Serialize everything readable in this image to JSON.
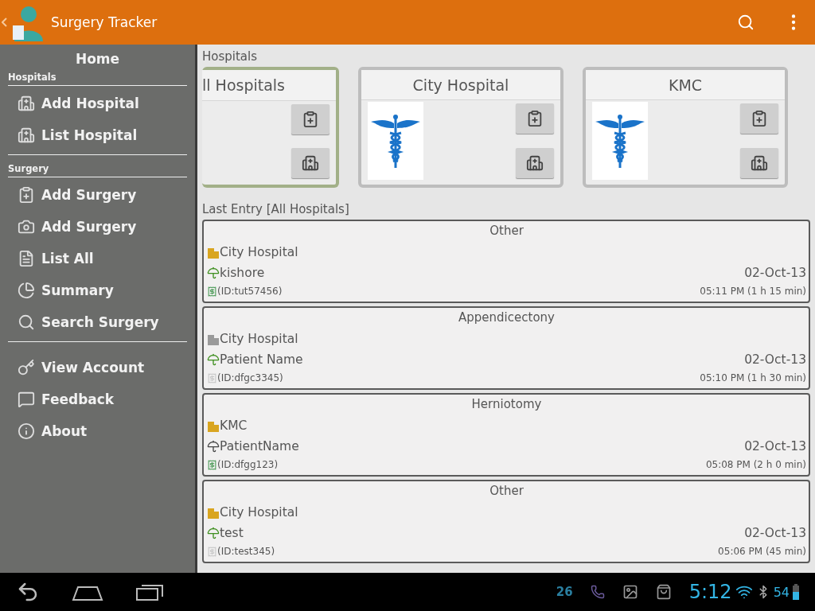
{
  "app_bar": {
    "title": "Surgery Tracker"
  },
  "drawer": {
    "title": "Home",
    "sections": [
      {
        "header": "Hospitals",
        "items": [
          {
            "label": "Add Hospital"
          },
          {
            "label": "List Hospital"
          }
        ]
      },
      {
        "header": "Surgery",
        "items": [
          {
            "label": "Add Surgery"
          },
          {
            "label": "Add Surgery"
          },
          {
            "label": "List All"
          },
          {
            "label": "Summary"
          },
          {
            "label": "Search Surgery"
          }
        ]
      },
      {
        "items": [
          {
            "label": "View Account"
          },
          {
            "label": "Feedback"
          },
          {
            "label": "About"
          }
        ]
      }
    ]
  },
  "hospitals": {
    "label": "Hospitals",
    "cards": [
      {
        "name": "ll Hospitals",
        "kind": "all",
        "selected": true
      },
      {
        "name": "City Hospital",
        "kind": "hospital",
        "selected": false
      },
      {
        "name": "KMC",
        "kind": "hospital",
        "selected": false
      }
    ]
  },
  "last_entry": {
    "label": "Last Entry [All Hospitals]",
    "entries": [
      {
        "surgery": "Other",
        "hospital": {
          "name": "City Hospital",
          "color": "#d9a520"
        },
        "patient": {
          "name": "kishore",
          "color": "#3f8f1f"
        },
        "id": {
          "text": "(ID:tut57456)",
          "color": "#4c9a58"
        },
        "date": "02-Oct-13",
        "time": "05:11 PM (1 h 15 min)"
      },
      {
        "surgery": "Appendicectony",
        "hospital": {
          "name": "City Hospital",
          "color": "#9a9a9a"
        },
        "patient": {
          "name": "Patient Name",
          "color": "#3f8f1f"
        },
        "id": {
          "text": "(ID:dfgc3345)",
          "color": "#c8c8c8"
        },
        "date": "02-Oct-13",
        "time": "05:10 PM (1 h 30 min)"
      },
      {
        "surgery": "Herniotomy",
        "hospital": {
          "name": "KMC",
          "color": "#d9a520"
        },
        "patient": {
          "name": "PatientName",
          "color": "#444444"
        },
        "id": {
          "text": "(ID:dfgg123)",
          "color": "#4c9a58"
        },
        "date": "02-Oct-13",
        "time": "05:08 PM (2 h 0 min)"
      },
      {
        "surgery": "Other",
        "hospital": {
          "name": "City Hospital",
          "color": "#d9a520"
        },
        "patient": {
          "name": "test",
          "color": "#3f8f1f"
        },
        "id": {
          "text": "(ID:test345)",
          "color": "#c8c8c8"
        },
        "date": "02-Oct-13",
        "time": "05:06 PM (45 min)"
      }
    ]
  },
  "system_bar": {
    "temperature": "26",
    "clock": "5:12",
    "battery": "54"
  }
}
